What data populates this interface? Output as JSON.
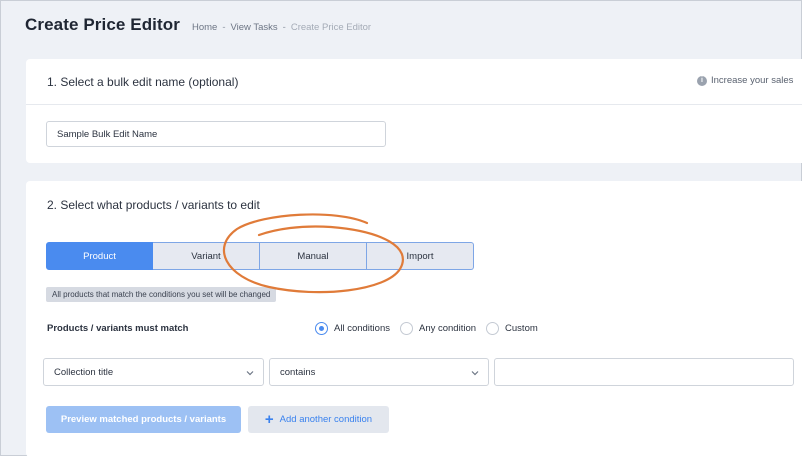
{
  "header": {
    "title": "Create Price Editor",
    "breadcrumb": {
      "home": "Home",
      "view_tasks": "View Tasks",
      "current": "Create Price Editor",
      "separator": "-"
    }
  },
  "section1": {
    "title": "1. Select a bulk edit name (optional)",
    "hint": "Increase your sales",
    "hint_icon": "info-icon",
    "name_input": {
      "value": "Sample Bulk Edit Name"
    }
  },
  "section2": {
    "title": "2. Select what products / variants to edit",
    "tabs": [
      "Product",
      "Variant",
      "Manual",
      "Import"
    ],
    "active_tab": "Product",
    "info_badge": "All products that match the conditions you set will be changed",
    "match_label": "Products / variants must match",
    "match_options": [
      "All conditions",
      "Any condition",
      "Custom"
    ],
    "match_selected": "All conditions",
    "condition": {
      "field": "Collection title",
      "operator": "contains",
      "value": ""
    },
    "preview_button": "Preview matched products / variants",
    "add_condition_button": "Add another condition",
    "add_icon": "plus-icon"
  },
  "colors": {
    "primary": "#4a8bef",
    "annotation": "#e07b39",
    "background": "#eef1f6"
  }
}
